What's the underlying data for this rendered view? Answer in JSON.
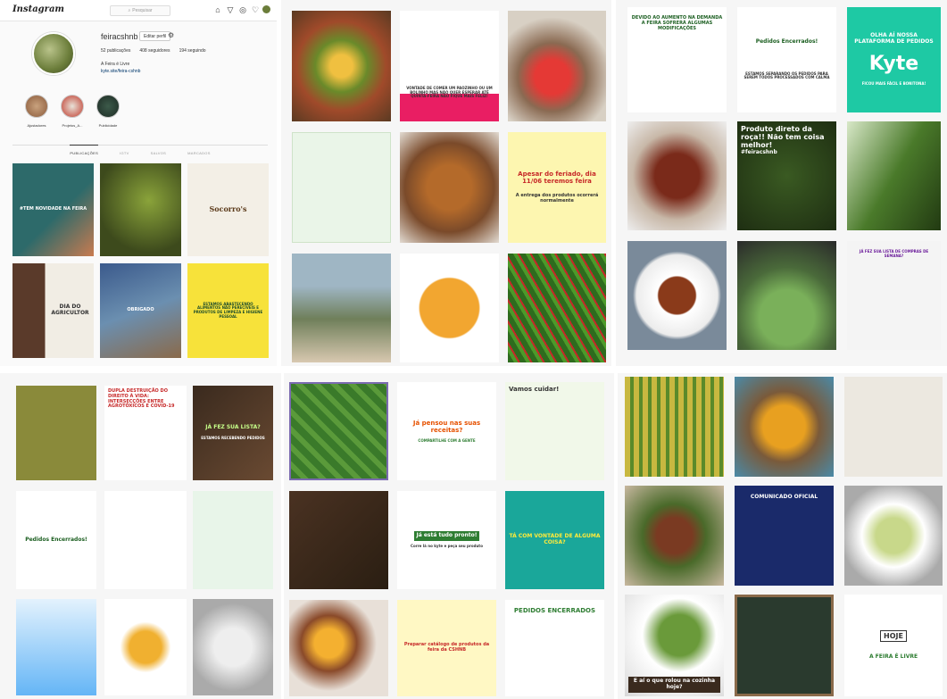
{
  "app": {
    "logo": "Instagram",
    "search_placeholder": "Pesquisar"
  },
  "profile": {
    "username": "feiracshnb",
    "edit_label": "Editar perfil",
    "posts": "52 publicações",
    "followers": "408 seguidores",
    "following": "194 seguindo",
    "bio_line1": "A Feira é Livre",
    "bio_link": "kyte.site/feira-cshnb"
  },
  "highlights": [
    "Ajustadores",
    "Projetos_A...",
    "Publicidade"
  ],
  "tabs": [
    "PUBLICAÇÕES",
    "IGTV",
    "SALVOS",
    "MARCADOS"
  ],
  "colors": {
    "green": "#2e7d32",
    "teal": "#1ec9a4",
    "blue": "#1565c0"
  },
  "posts": {
    "ig1": "#TEM NOVIDADE NA FEIRA",
    "ig3": "Socorro's",
    "ig4a": "DIA DO AGRICULTOR",
    "ig5": "OBRIGADO",
    "ig6": "ESTAMOS ABASTECENDO ALIMENTOS NÃO PERECÍVEIS E PRODUTOS DE LIMPEZA E HIGIENE PESSOAL",
    "t2": "VONTADE DE COMER UM PAOZINHO OU UM BOLINHO MAS NÃO QUER ESPERAR ATÉ QUINTA-FEIRA NÃO FIQUE MAIS FELIZ!",
    "t6a": "Apesar do feriado, dia 11/06 teremos feira",
    "t6b": "A entrega dos produtos ocorrerá normalmente",
    "r1": "DEVIDO AO AUMENTO NA DEMANDA A FEIRA SOFRERÁ ALGUMAS MODIFICAÇÕES",
    "r2a": "Pedidos Encerrados!",
    "r2b": "ESTAMOS SEPARANDO OS PEDIDOS PARA SEREM TODOS PROCESSADOS COM CALMA",
    "r3a": "OLHA AÍ NOSSA PLATAFORMA DE PEDIDOS",
    "r3b": "Kyte",
    "r3c": "FICOU MAIS FÁCIL E BONITONA!",
    "r5": "Produto direto da roça!! Não tem coisa melhor!",
    "r5b": "#feiracshnb",
    "r9": "JÁ FEZ SUA LISTA DE COMPRAS DE SEMANA?",
    "b2": "DUPLA DESTRUIÇÃO DO DIREITO À VIDA: INTERSECÇÕES ENTRE AGROTÓXICOS E COVID-19",
    "b3a": "JÁ FEZ SUA LISTA?",
    "b3b": "ESTAMOS RECEBENDO PEDIDOS",
    "b4": "Pedidos Encerrados!",
    "b7": "Vamos cuidar!",
    "c2a": "Já pensou nas suas receitas?",
    "c2b": "COMPARTILHE COM A GENTE",
    "c3a": "Já está tudo pronto!",
    "c3b": "Corre lá no kyte e peça seu produto",
    "c4": "TÁ COM VONTADE DE ALGUMA COISA?",
    "c6": "PEDIDOS ENCERRADOS",
    "c8": "Preparar catálogo de produtos da feira da CSHNB",
    "d2": "COMUNICADO OFICIAL",
    "d6a": "HOJE",
    "d6b": "A FEIRA É LIVRE",
    "d6c": "E aí o que rolou na cozinha hoje?"
  }
}
